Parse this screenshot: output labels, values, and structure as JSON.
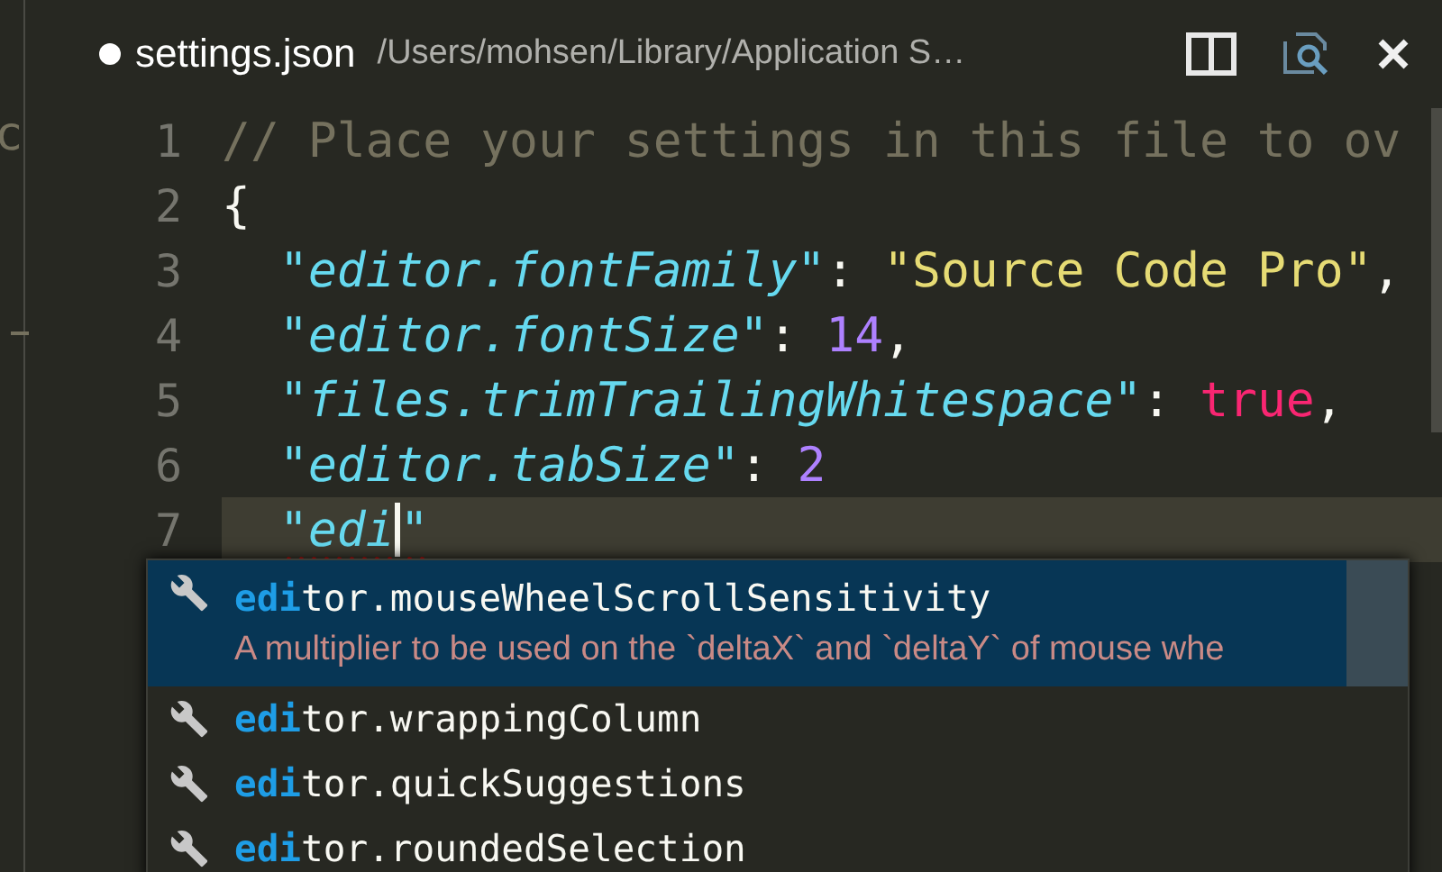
{
  "side_pane": {
    "text": "c"
  },
  "tab": {
    "dirty": true,
    "title": "settings.json",
    "path": "/Users/mohsen/Library/Application S…"
  },
  "editor": {
    "lines": [
      {
        "number": "1",
        "current": false,
        "indent": false,
        "tokens": [
          {
            "kind": "comment",
            "text": "// Place your settings in this file to ov"
          }
        ]
      },
      {
        "number": "2",
        "current": false,
        "indent": false,
        "tokens": [
          {
            "kind": "punct",
            "text": "{"
          }
        ]
      },
      {
        "number": "3",
        "current": false,
        "indent": true,
        "tokens": [
          {
            "kind": "key",
            "text": "\"editor.fontFamily\""
          },
          {
            "kind": "punct",
            "text": ": "
          },
          {
            "kind": "string",
            "text": "\"Source Code Pro\""
          },
          {
            "kind": "punct",
            "text": ","
          }
        ]
      },
      {
        "number": "4",
        "current": false,
        "indent": true,
        "tokens": [
          {
            "kind": "key",
            "text": "\"editor.fontSize\""
          },
          {
            "kind": "punct",
            "text": ": "
          },
          {
            "kind": "number",
            "text": "14"
          },
          {
            "kind": "punct",
            "text": ","
          }
        ]
      },
      {
        "number": "5",
        "current": false,
        "indent": true,
        "tokens": [
          {
            "kind": "key",
            "text": "\"files.trimTrailingWhitespace\""
          },
          {
            "kind": "punct",
            "text": ": "
          },
          {
            "kind": "keyword",
            "text": "true"
          },
          {
            "kind": "punct",
            "text": ","
          }
        ]
      },
      {
        "number": "6",
        "current": false,
        "indent": true,
        "tokens": [
          {
            "kind": "key",
            "text": "\"editor.tabSize\""
          },
          {
            "kind": "punct",
            "text": ": "
          },
          {
            "kind": "number",
            "text": "2"
          }
        ]
      },
      {
        "number": "7",
        "current": true,
        "indent": true,
        "tokens": [
          {
            "kind": "key",
            "text": "\"edi",
            "misspelled": true
          },
          {
            "kind": "cursor"
          },
          {
            "kind": "key",
            "text": "\"",
            "misspelled": true
          }
        ]
      }
    ]
  },
  "suggestions": [
    {
      "match": "edi",
      "rest": "tor.mouseWheelScrollSensitivity",
      "selected": true,
      "description": "A multiplier to be used on the `deltaX` and `deltaY` of mouse whe"
    },
    {
      "match": "edi",
      "rest": "tor.wrappingColumn",
      "selected": false
    },
    {
      "match": "edi",
      "rest": "tor.quickSuggestions",
      "selected": false
    },
    {
      "match": "edi",
      "rest": "tor.roundedSelection",
      "selected": false
    }
  ]
}
